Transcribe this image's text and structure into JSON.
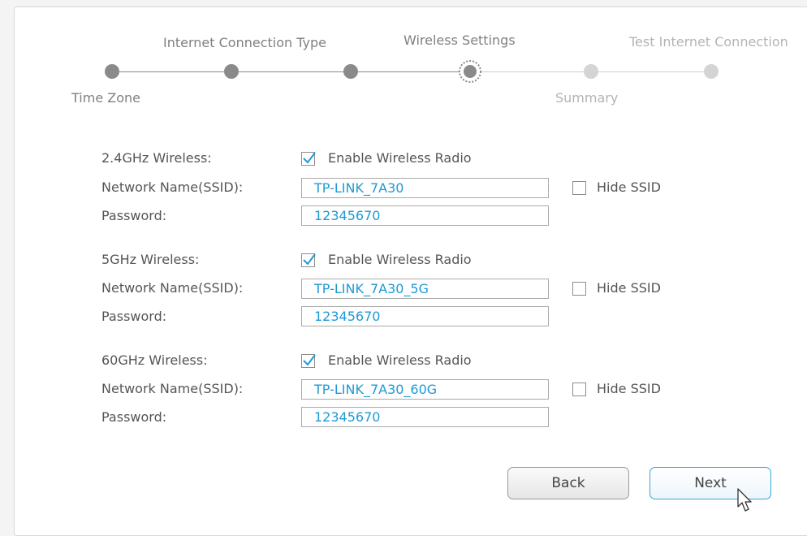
{
  "stepper": {
    "steps": [
      {
        "label": "Time Zone",
        "state": "done"
      },
      {
        "label": "Internet Connection Type",
        "state": "done"
      },
      {
        "label": "",
        "state": "done"
      },
      {
        "label": "Wireless Settings",
        "state": "current"
      },
      {
        "label": "Summary",
        "state": "todo"
      },
      {
        "label": "Test Internet Connection",
        "state": "todo"
      }
    ]
  },
  "wireless": [
    {
      "band_label": "2.4GHz Wireless:",
      "enable_label": "Enable Wireless Radio",
      "enabled": true,
      "ssid_label": "Network Name(SSID):",
      "ssid_value": "TP-LINK_7A30",
      "hide_label": "Hide SSID",
      "hidden": false,
      "password_label": "Password:",
      "password_value": "12345670"
    },
    {
      "band_label": "5GHz Wireless:",
      "enable_label": "Enable Wireless Radio",
      "enabled": true,
      "ssid_label": "Network Name(SSID):",
      "ssid_value": "TP-LINK_7A30_5G",
      "hide_label": "Hide SSID",
      "hidden": false,
      "password_label": "Password:",
      "password_value": "12345670"
    },
    {
      "band_label": "60GHz Wireless:",
      "enable_label": "Enable Wireless Radio",
      "enabled": true,
      "ssid_label": "Network Name(SSID):",
      "ssid_value": "TP-LINK_7A30_60G",
      "hide_label": "Hide SSID",
      "hidden": false,
      "password_label": "Password:",
      "password_value": "12345670"
    }
  ],
  "buttons": {
    "back": "Back",
    "next": "Next"
  },
  "colors": {
    "accent": "#1e9ad6",
    "done": "#8a8a8a",
    "todo": "#d4d4d4"
  }
}
